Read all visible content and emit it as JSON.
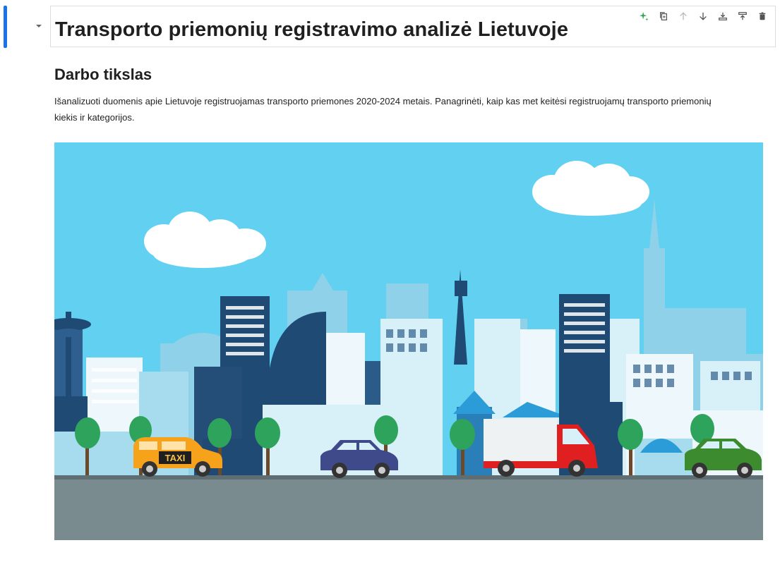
{
  "notebook": {
    "heading_cell": {
      "title": "Transporto priemonių registravimo analizė Lietuvoje",
      "toolbar": [
        {
          "name": "sparkle-ai-icon",
          "color": "#34a853"
        },
        {
          "name": "duplicate-icon",
          "color": "#555555"
        },
        {
          "name": "move-up-icon",
          "color": "#bbbbbb"
        },
        {
          "name": "move-down-icon",
          "color": "#555555"
        },
        {
          "name": "insert-below-icon",
          "color": "#555555"
        },
        {
          "name": "merge-icon",
          "color": "#555555"
        },
        {
          "name": "delete-icon",
          "color": "#555555"
        }
      ]
    },
    "markdown_cell": {
      "section_heading": "Darbo tikslas",
      "paragraph": "Išanalizuoti duomenis apie Lietuvoje registruojamas transporto priemones 2020-2024 metais. Panagrinėti, kaip kas met keitėsi registruojamų transporto priemonių kiekis ir kategorijos.",
      "image": {
        "taxi_sign": "TAXI",
        "colors": {
          "sky": "#62d0f0",
          "road": "#7a8b8f",
          "taxi": "#f7a21b",
          "car_blue": "#3f4a8a",
          "truck_red": "#e02020",
          "car_green": "#3d8b2f",
          "tree": "#2ea35c"
        }
      }
    }
  },
  "colors": {
    "active_indicator": "#1a73e8",
    "cell_border": "#dddddd"
  }
}
